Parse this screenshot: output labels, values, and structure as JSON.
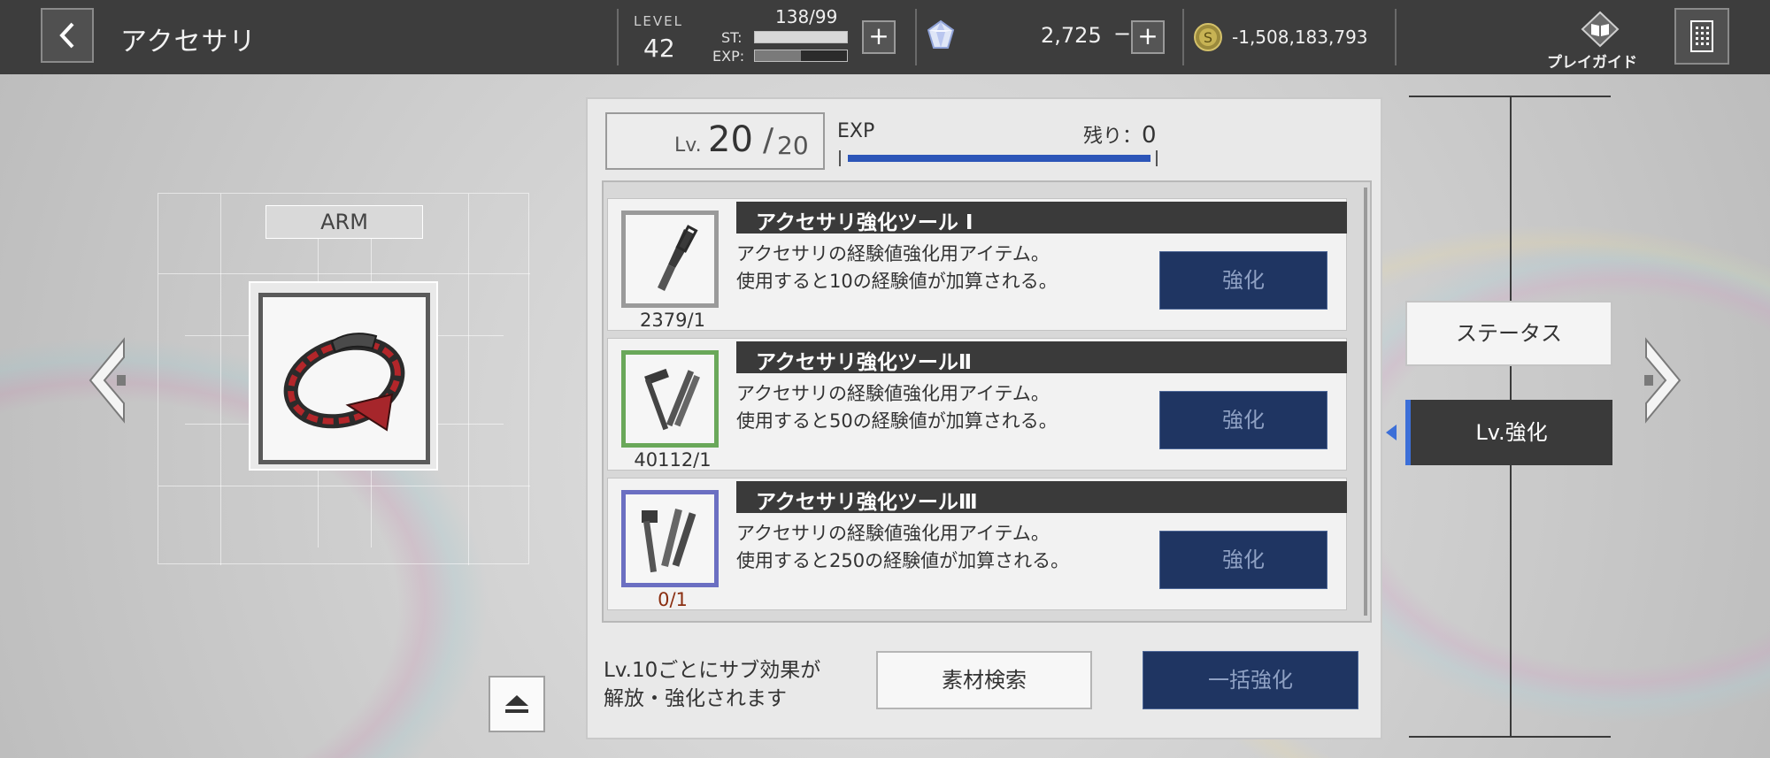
{
  "header": {
    "back_icon": "chevron-left-icon",
    "title": "アクセサリ",
    "level_label": "LEVEL",
    "level_value": "42",
    "st_label": "ST:",
    "st_value": "138/99",
    "st_fill": 1.0,
    "exp_label": "EXP:",
    "exp_fill": 0.5,
    "gem_icon": "crystal-icon",
    "gem_value": "2,725",
    "gem_minus": "−",
    "coin_icon": "coin-icon",
    "coin_value": "-1,508,183,793",
    "guide_label": "プレイガイド",
    "guide_icon": "book-icon",
    "menu_icon": "grid-menu-icon"
  },
  "item": {
    "slot_label": "ARM",
    "image_icon": "bracelet-icon"
  },
  "level_panel": {
    "lv_prefix": "Lv.",
    "lv_current": "20",
    "lv_slash": "/",
    "lv_max": "20",
    "exp_title": "EXP",
    "exp_remaining_label": "残り：",
    "exp_remaining_value": "0",
    "exp_fill": 1.0
  },
  "materials": [
    {
      "name": "アクセサリ強化ツール Ⅰ",
      "desc_line1": "アクセサリの経験値強化用アイテム。",
      "desc_line2": "使用すると10の経験値が加算される。",
      "count": "2379/1",
      "button": "強化",
      "frame_color": "#9a9a9a"
    },
    {
      "name": "アクセサリ強化ツールⅡ",
      "desc_line1": "アクセサリの経験値強化用アイテム。",
      "desc_line2": "使用すると50の経験値が加算される。",
      "count": "40112/1",
      "button": "強化",
      "frame_color": "#6aa85a"
    },
    {
      "name": "アクセサリ強化ツールⅢ",
      "desc_line1": "アクセサリの経験値強化用アイテム。",
      "desc_line2": "使用すると250の経験値が加算される。",
      "count": "0/1",
      "button": "強化",
      "frame_color": "#6b6fc2"
    }
  ],
  "footer": {
    "note_line1": "Lv.10ごとにサブ効果が",
    "note_line2": "解放・強化されます",
    "search_button": "素材検索",
    "bulk_button": "一括強化"
  },
  "tabs": {
    "status": "ステータス",
    "lv_enhance": "Lv.強化"
  },
  "colors": {
    "enhance_button": "#1f3562",
    "active_tab_accent": "#3c6fd8",
    "exp_bar": "#2c55b8"
  }
}
